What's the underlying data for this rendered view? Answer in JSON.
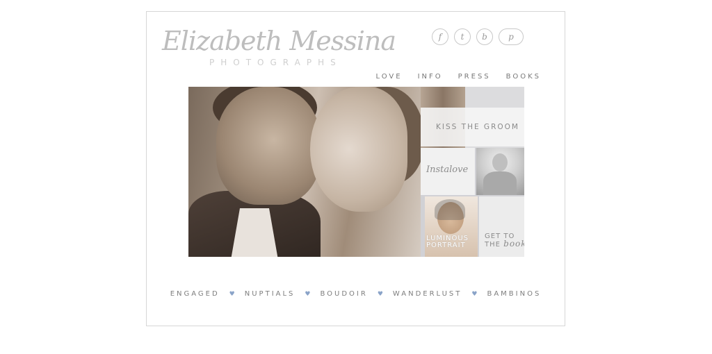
{
  "logo": {
    "script": "Elizabeth Messina",
    "sub": "PHOTOGRAPHS"
  },
  "social": [
    "facebook-icon",
    "twitter-icon",
    "blog-icon",
    "pinterest-icon"
  ],
  "topnav": [
    "LOVE",
    "INFO",
    "PRESS",
    "BOOKS"
  ],
  "tiles": {
    "kiss": "KISS THE GROOM",
    "instalove": "Instalove",
    "portrait": "LUMINOUS\nPORTRAIT",
    "book_line1": "GET TO",
    "book_line2": "THE",
    "book_script": "book"
  },
  "bottomnav": [
    "ENGAGED",
    "NUPTIALS",
    "BOUDOIR",
    "WANDERLUST",
    "BAMBINOS"
  ],
  "separator": "♥",
  "colors": {
    "border": "#d6d6d6",
    "text": "#7d7d7d",
    "heart": "#8aa3c8"
  }
}
